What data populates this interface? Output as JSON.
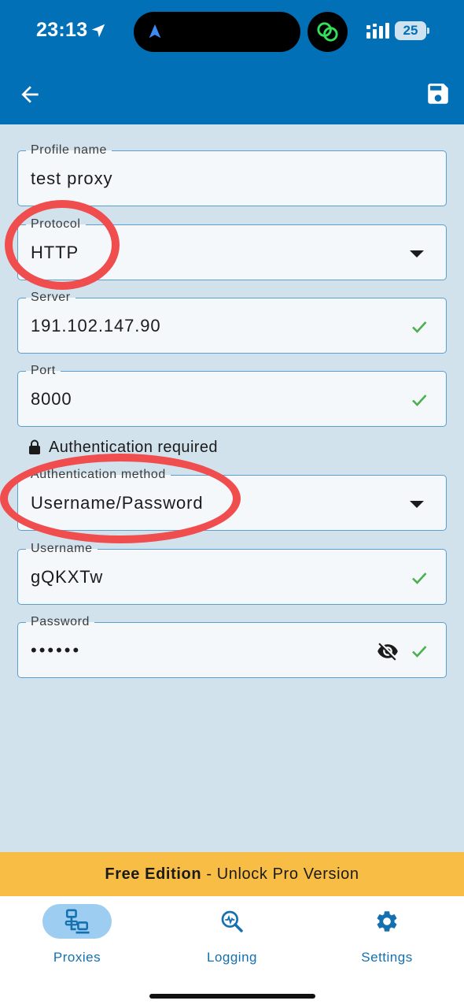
{
  "status_bar": {
    "time": "23:13",
    "battery": "25",
    "icons": [
      "location-arrow-icon",
      "navigation-icon",
      "linked-rings-icon",
      "cellular-signal-icon",
      "battery-icon"
    ]
  },
  "app_bar": {
    "back_icon": "back-arrow-icon",
    "save_icon": "save-floppy-icon",
    "color": "#0270b6"
  },
  "form": {
    "profile_name": {
      "label": "Profile name",
      "value": "test proxy"
    },
    "protocol": {
      "label": "Protocol",
      "value": "HTTP"
    },
    "server": {
      "label": "Server",
      "value": "191.102.147.90"
    },
    "port": {
      "label": "Port",
      "value": "8000"
    },
    "auth_note": {
      "text": "Authentication required",
      "icon": "lock-icon"
    },
    "auth_method": {
      "label": "Authentication method",
      "value": "Username/Password"
    },
    "username": {
      "label": "Username",
      "value": "gQKXTw"
    },
    "password": {
      "label": "Password",
      "value": "••••••",
      "icon": "eye-off-icon"
    }
  },
  "promo": {
    "bold": "Free Edition",
    "rest": " - Unlock Pro Version",
    "color": "#f8bd44"
  },
  "bottom_nav": {
    "items": [
      {
        "label": "Proxies",
        "icon": "proxies-network-icon",
        "active": true
      },
      {
        "label": "Logging",
        "icon": "logging-search-icon",
        "active": false
      },
      {
        "label": "Settings",
        "icon": "settings-gear-icon",
        "active": false
      }
    ]
  },
  "colors": {
    "background": "#d2e2ec",
    "field_border": "#5b9fce",
    "valid_check": "#4caf50",
    "annotation": "#f04d4f"
  }
}
